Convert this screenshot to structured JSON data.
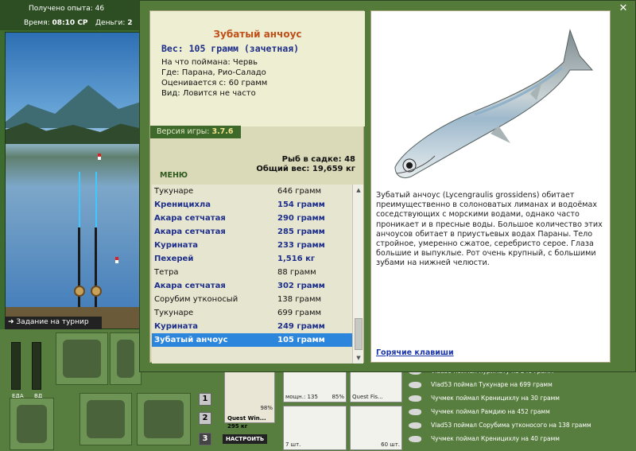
{
  "hud": {
    "experience": "Получено опыта: 46",
    "time_label": "Время:",
    "time_value": "08:10 СР",
    "money_label": "Деньги:",
    "money_value": "2"
  },
  "tournament_label": "Задание на турнир",
  "meters": {
    "food": "ЕДА",
    "drink": "ВД"
  },
  "page_buttons": [
    "1",
    "2",
    "3"
  ],
  "tackle": {
    "item_name": "Quest Win...",
    "item_weight": "295 кг",
    "percent": "98%",
    "setup_button": "НАСТРОИТЬ",
    "slot1_left": "мощн.: 135",
    "slot1_right": "85%",
    "slot2_label": "Quest Fis...",
    "hook_count": "7 шт.",
    "worm_count": "60 шт."
  },
  "log": [
    "Vlad53 поймал Куриматy на 249 грамм",
    "Vlad53 поймал Тукунаре на 699 грамм",
    "Чучмек поймал Креницихлу на 30 грамм",
    "Чучмек поймал Рамдию на 452 грамм",
    "Vlad53 поймал Сорубима утконосого на 138 грамм",
    "Чучмек поймал Креницихлу на 40 грамм"
  ],
  "card": {
    "title": "Зубатый анчоус",
    "weight": "Вес: 105 грамм (зачетная)",
    "caught_on": "На что поймана: Червь",
    "where": "Где: Парана, Рио-Саладо",
    "value": "Оценивается с: 60 грамм",
    "kind": "Вид: Ловится не часто"
  },
  "version": {
    "label": "Версия игры:",
    "value": "3.7.6"
  },
  "menu_label": "МЕНЮ",
  "cage": {
    "count": "Рыб в садке: 48",
    "total": "Общий вес: 19,659 кг"
  },
  "catch_list": [
    {
      "name": "Тукунаре",
      "weight": "646 грамм",
      "trophy": false
    },
    {
      "name": "Креницихла",
      "weight": "154 грамм",
      "trophy": true
    },
    {
      "name": "Акара сетчатая",
      "weight": "290 грамм",
      "trophy": true
    },
    {
      "name": "Акара сетчатая",
      "weight": "285 грамм",
      "trophy": true
    },
    {
      "name": "Курината",
      "weight": "233 грамм",
      "trophy": true
    },
    {
      "name": "Пехерей",
      "weight": "1,516 кг",
      "trophy": true
    },
    {
      "name": "Тетра",
      "weight": "88 грамм",
      "trophy": false
    },
    {
      "name": "Акара сетчатая",
      "weight": "302 грамм",
      "trophy": true
    },
    {
      "name": "Сорубим утконосый",
      "weight": "138 грамм",
      "trophy": false
    },
    {
      "name": "Тукунаре",
      "weight": "699 грамм",
      "trophy": false
    },
    {
      "name": "Курината",
      "weight": "249 грамм",
      "trophy": true
    },
    {
      "name": "Зубатый анчоус",
      "weight": "105 грамм",
      "trophy": true,
      "selected": true
    }
  ],
  "description": "Зубатый анчоус (Lycengraulis grossidens) обитает преимущественно в солоноватых лиманах и водоёмах соседствующих с морскими водами, однако часто проникает и в пресные воды. Большое количество этих анчоусов обитает в приустьевых водах Параны. Тело стройное, умеренно сжатое, серебристо серое. Глаза большие и выпуклые. Рот очень крупный, с большими зубами на нижней челюсти.",
  "hotkeys_label": "Горячие клавиши",
  "colors": {
    "panel_green": "#547b3a",
    "title_orange": "#c0501a",
    "trophy_blue": "#1d2e8c",
    "selection": "#2b86dc"
  }
}
